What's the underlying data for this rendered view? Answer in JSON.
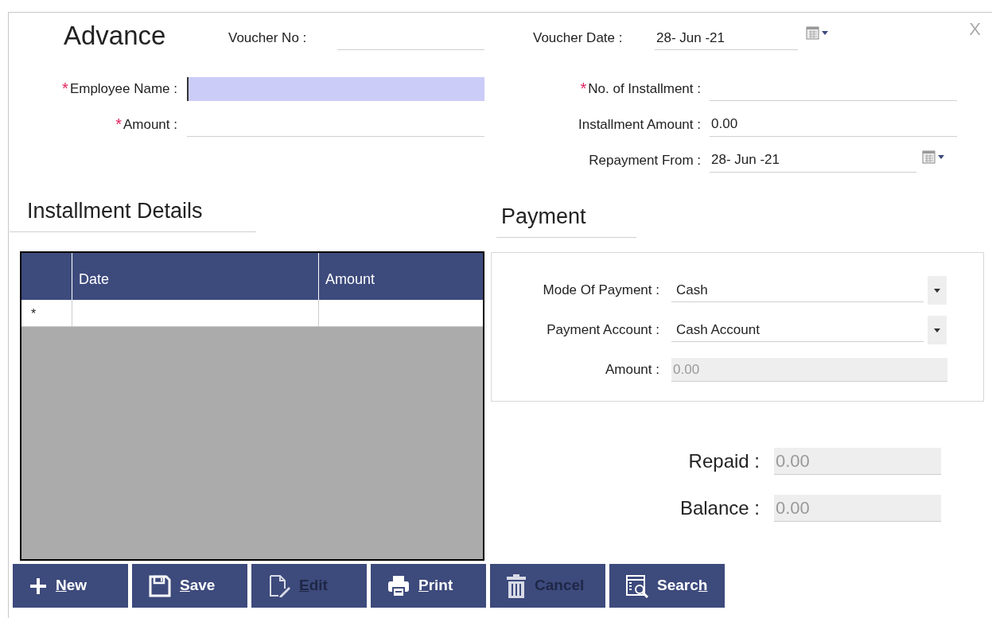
{
  "title": "Advance",
  "close": "X",
  "voucher_no": {
    "label": "Voucher No :"
  },
  "voucher_date": {
    "label": "Voucher Date :",
    "value": "28- Jun -21"
  },
  "left_fields": [
    {
      "label": "Employee Name :",
      "marker": "*",
      "focused": true
    },
    {
      "label": "Amount :",
      "marker": "*",
      "focused": false
    }
  ],
  "right_fields": [
    {
      "label": "No. of Installment :",
      "marker": "*",
      "kind": "text"
    },
    {
      "label": "Installment Amount :",
      "value": "0.00",
      "kind": "text"
    },
    {
      "label": "Repayment From :",
      "value": "28- Jun -21",
      "kind": "date"
    }
  ],
  "installment_details": {
    "heading": "Installment Details",
    "columns": [
      "Date",
      "Amount"
    ],
    "new_row_marker": "*"
  },
  "payment": {
    "heading": "Payment",
    "fields": [
      {
        "label": "Mode Of Payment :",
        "value": "Cash",
        "kind": "dropdown"
      },
      {
        "label": "Payment Account :",
        "value": "Cash Account",
        "kind": "dropdown"
      },
      {
        "label": "Amount :",
        "value": "0.00",
        "kind": "readonly"
      }
    ]
  },
  "totals": [
    {
      "label": "Repaid :",
      "value": "0.00"
    },
    {
      "label": "Balance :",
      "value": "0.00"
    }
  ],
  "buttons": [
    {
      "label_parts": [
        {
          "text": "N",
          "underlined": true
        },
        {
          "text": "ew",
          "underlined": false
        }
      ],
      "kind": "new",
      "disabled": false
    },
    {
      "label_parts": [
        {
          "text": "S",
          "underlined": true
        },
        {
          "text": "ave",
          "underlined": false
        }
      ],
      "kind": "save",
      "disabled": false
    },
    {
      "label_parts": [
        {
          "text": "E",
          "underlined": true
        },
        {
          "text": "dit",
          "underlined": false
        }
      ],
      "kind": "edit",
      "disabled": true
    },
    {
      "label_parts": [
        {
          "text": "P",
          "underlined": true
        },
        {
          "text": "rint",
          "underlined": false
        }
      ],
      "kind": "print",
      "disabled": false
    },
    {
      "label_parts": [
        {
          "text": "Cancel",
          "underlined": false
        }
      ],
      "kind": "cancel",
      "disabled": true
    },
    {
      "label_parts": [
        {
          "text": "Searc",
          "underlined": false
        },
        {
          "text": "h",
          "underlined": true
        }
      ],
      "kind": "search",
      "disabled": false
    }
  ]
}
